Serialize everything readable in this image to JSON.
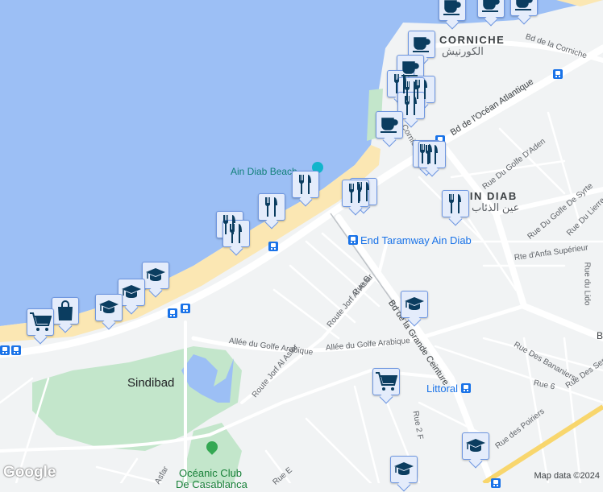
{
  "areas": {
    "corniche": "CORNICHE",
    "corniche_ar": "الكورنيش",
    "ain_diab": "AIN DIAB",
    "ain_diab_ar": "عين الذئاب",
    "beach": "Ain Diab Beach",
    "sindibad": "Sindibad",
    "oceanic_1": "Océanic Club",
    "oceanic_2": "De Casablanca"
  },
  "streets": {
    "bd_corniche": "Bd de la Corniche",
    "bd_ocean": "Bd de l'Océan Atlantique",
    "corniche_small": "Corniche",
    "golfe_aden": "Rue Du Golfe D'Aden",
    "golfe_syrte": "Rue Du Golfe De Syrte",
    "lierre": "Rue Du Lierre",
    "anfa": "Rte d'Anfa Supérieur",
    "lido": "Rue du Lido",
    "rue_b": "Rue B",
    "jorf1": "Route Jorf Al Asfar",
    "jorf2": "Route Jorf Al Asfar",
    "golfe_arabique1": "Allée du Golfe Arabique",
    "golfe_arabique2": "Allée du Golfe Arabique",
    "grande_ceinture": "Bd de la Grande Ceinture",
    "bananiers": "Rue Des Bananiers",
    "rue6": "Rue 6",
    "seringas": "Rue Des Seri",
    "poiriers": "Rue des Poiriers",
    "rue2f": "Rue 2 F",
    "rue_e": "Rue E",
    "asfar_small": "Asfar",
    "bd_right": "B"
  },
  "transit": {
    "taramway": "End Taramway Ain Diab",
    "littoral": "Littoral"
  },
  "markers": [
    {
      "type": "cafe"
    },
    {
      "type": "cafe"
    },
    {
      "type": "cafe"
    },
    {
      "type": "cafe"
    },
    {
      "type": "cafe"
    },
    {
      "type": "restaurant"
    },
    {
      "type": "restaurant"
    },
    {
      "type": "restaurant"
    },
    {
      "type": "restaurant"
    },
    {
      "type": "cafe"
    },
    {
      "type": "restaurant"
    },
    {
      "type": "restaurant"
    },
    {
      "type": "restaurant"
    },
    {
      "type": "restaurant"
    },
    {
      "type": "restaurant"
    },
    {
      "type": "restaurant"
    },
    {
      "type": "restaurant"
    },
    {
      "type": "restaurant"
    },
    {
      "type": "restaurant"
    },
    {
      "type": "school"
    },
    {
      "type": "school"
    },
    {
      "type": "school"
    },
    {
      "type": "school"
    },
    {
      "type": "shopping"
    },
    {
      "type": "grocery"
    },
    {
      "type": "grocery"
    },
    {
      "type": "school"
    },
    {
      "type": "school"
    }
  ],
  "footer": {
    "logo": "Google",
    "attribution": "Map data ©2024"
  },
  "colors": {
    "water": "#9cbff5",
    "beach": "#fbe7b3",
    "park": "#c3e6cb",
    "land": "#f1f3f4",
    "marker_icon": "#0b3d60",
    "transit": "#1a73e8",
    "highway": "#f8d66d"
  }
}
